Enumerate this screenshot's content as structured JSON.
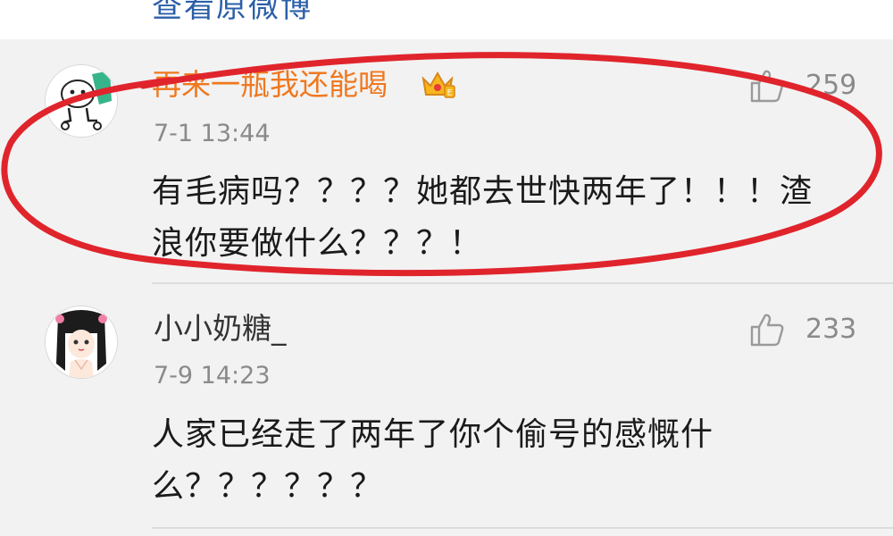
{
  "header_partial_text": "查看原微博",
  "comments": [
    {
      "username": "再来一瓶我还能喝",
      "timestamp": "7-1 13:44",
      "text": "有毛病吗？？？？她都去世快两年了！！！渣\n浪你要做什么？？？！",
      "likes": "259",
      "vip_icon": "crown-icon"
    },
    {
      "username": "小小奶糖_",
      "timestamp": "7-9 14:23",
      "text": "人家已经走了两年了你个偷号的感慨什\n么？？？？？？",
      "likes": "233"
    }
  ],
  "colors": {
    "vip_name": "#f0781e",
    "annotation": "#e0242c",
    "link": "#2b5fa8"
  }
}
